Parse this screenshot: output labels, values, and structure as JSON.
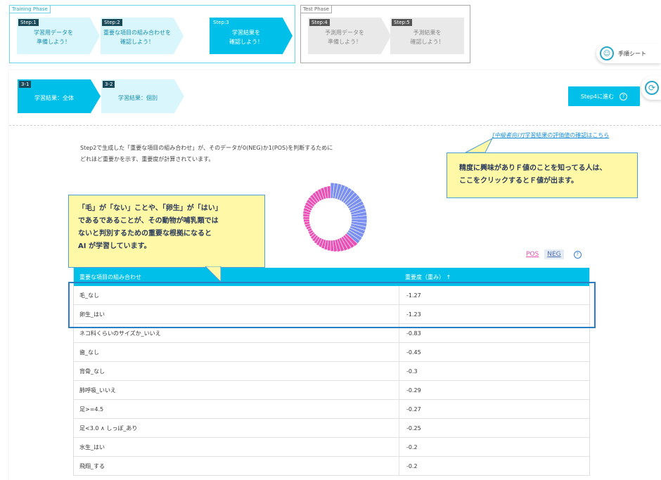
{
  "header": {
    "training_phase_label": "Training Phase",
    "test_phase_label": "Test Phase",
    "steps": [
      {
        "tag": "Step:1",
        "line1": "学習用データを",
        "line2": "準備しよう！"
      },
      {
        "tag": "Step:2",
        "line1": "重要な項目の組み合わせを",
        "line2": "確認しよう！"
      },
      {
        "tag": "Step:3",
        "line1": "学習結果を",
        "line2": "確認しよう！"
      },
      {
        "tag": "Step:4",
        "line1": "予測用データを",
        "line2": "準備しよう！"
      },
      {
        "tag": "Step:5",
        "line1": "予測結果を",
        "line2": "確認しよう！"
      }
    ],
    "manual_label": "手順シート"
  },
  "substeps": [
    {
      "tag": "3-1",
      "label": "学習結果：全体"
    },
    {
      "tag": "3-2",
      "label": "学習結果：個別"
    }
  ],
  "next_button": "Step4に進む",
  "link_prefix": "[中級者向け]",
  "link_text": "学習結果の評価値の確認はこちら",
  "description": {
    "line1": "Step2で生成した「重要な項目の組み合わせ」が、そのデータが0(NEG)か1(POS)を判断するために",
    "line2": "どれほど重要かを示す、重要度が計算されています。"
  },
  "callout_right": {
    "line1": "精度に興味がありＦ値のことを知ってる人は、",
    "line2": "ここをクリックするとＦ値が出ます。"
  },
  "callout_left": {
    "line1": "「毛」が「ない」ことや、「卵生」が「はい」",
    "line2": "であるであることが、その動物が哺乳類では",
    "line3": "ないと判別するための重要な根拠になると",
    "line4": "AI が学習しています。"
  },
  "toggle": {
    "pos": "POS",
    "neg": "NEG"
  },
  "table": {
    "col1": "重要な項目の組み合わせ",
    "col2": "重要度（重み）",
    "sort_icon": "↑",
    "rows": [
      {
        "combo": "毛_なし",
        "weight": "-1.27"
      },
      {
        "combo": "卵生_はい",
        "weight": "-1.23"
      },
      {
        "combo": "ネコ科くらいのサイズか_いいえ",
        "weight": "-0.83"
      },
      {
        "combo": "歯_なし",
        "weight": "-0.45"
      },
      {
        "combo": "背骨_なし",
        "weight": "-0.3"
      },
      {
        "combo": "肺呼吸_いいえ",
        "weight": "-0.29"
      },
      {
        "combo": "足>=4.5",
        "weight": "-0.27"
      },
      {
        "combo": "足<3.0 ∧ しっぽ_あり",
        "weight": "-0.25"
      },
      {
        "combo": "水生_はい",
        "weight": "-0.2"
      },
      {
        "combo": "飛翔_する",
        "weight": "-0.2"
      }
    ]
  },
  "colors": {
    "accent": "#00c0ea",
    "pos": "#e94fb4",
    "neg": "#7a8ff0",
    "callout": "#fff8a6"
  }
}
